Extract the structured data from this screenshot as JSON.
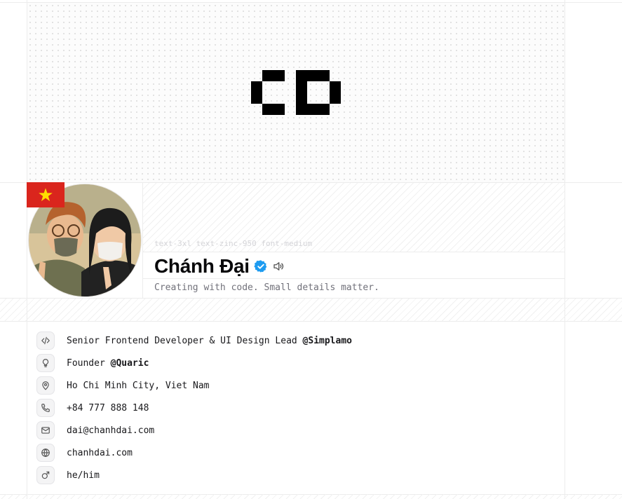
{
  "header": {
    "class_hint": "text-3xl text-zinc-950 font-medium",
    "name": "Chánh Đại",
    "tagline": "Creating with code. Small details matter."
  },
  "icons": {
    "verified": "verified-badge-icon",
    "pronounce": "speaker-icon",
    "flag": "vietnam-flag-icon"
  },
  "colors": {
    "flag_red": "#da251d",
    "flag_star": "#ffde00",
    "verified_blue": "#1d9bf0"
  },
  "info": [
    {
      "icon": "code-icon",
      "text": "Senior Frontend Developer & UI Design Lead ",
      "strong": "@Simplamo"
    },
    {
      "icon": "lightbulb-icon",
      "text": "Founder ",
      "strong": "@Quaric"
    },
    {
      "icon": "map-pin-icon",
      "text": "Ho Chi Minh City, Viet Nam",
      "strong": ""
    },
    {
      "icon": "phone-icon",
      "text": "+84 777 888 148",
      "strong": ""
    },
    {
      "icon": "mail-icon",
      "text": "dai@chanhdai.com",
      "strong": ""
    },
    {
      "icon": "globe-icon",
      "text": "chanhdai.com",
      "strong": ""
    },
    {
      "icon": "mars-icon",
      "text": "he/him",
      "strong": ""
    }
  ]
}
